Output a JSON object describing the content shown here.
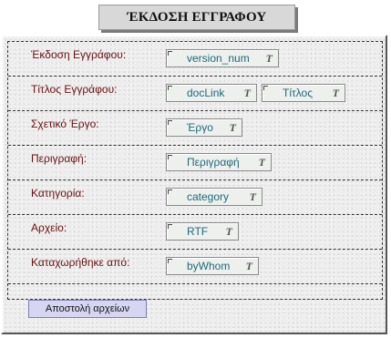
{
  "title": "ΈΚΔΟΣΗ ΕΓΓΡΑΦΟΥ",
  "fields": [
    {
      "label": "Έκδοση Εγγράφου:",
      "values": [
        "version_num"
      ]
    },
    {
      "label": "Τίτλος Εγγράφου:",
      "values": [
        "docLink",
        "Τίτλος"
      ]
    },
    {
      "label": "Σχετικό Έργο:",
      "values": [
        "Έργο"
      ]
    },
    {
      "label": "Περιγραφή:",
      "values": [
        "Περιγραφή"
      ]
    },
    {
      "label": "Κατηγορία:",
      "values": [
        "category"
      ]
    },
    {
      "label": "Αρχείο:",
      "values": [
        "RTF"
      ]
    },
    {
      "label": "Καταχωρήθηκε από:",
      "values": [
        "byWhom"
      ]
    }
  ],
  "field_type_glyph": "T",
  "send_button": "Αποστολή αρχείων",
  "colors": {
    "label": "#6a1010",
    "value": "#1a6a7a",
    "button_bg": "#d6d6f2",
    "panel_bg": "#ededed"
  }
}
